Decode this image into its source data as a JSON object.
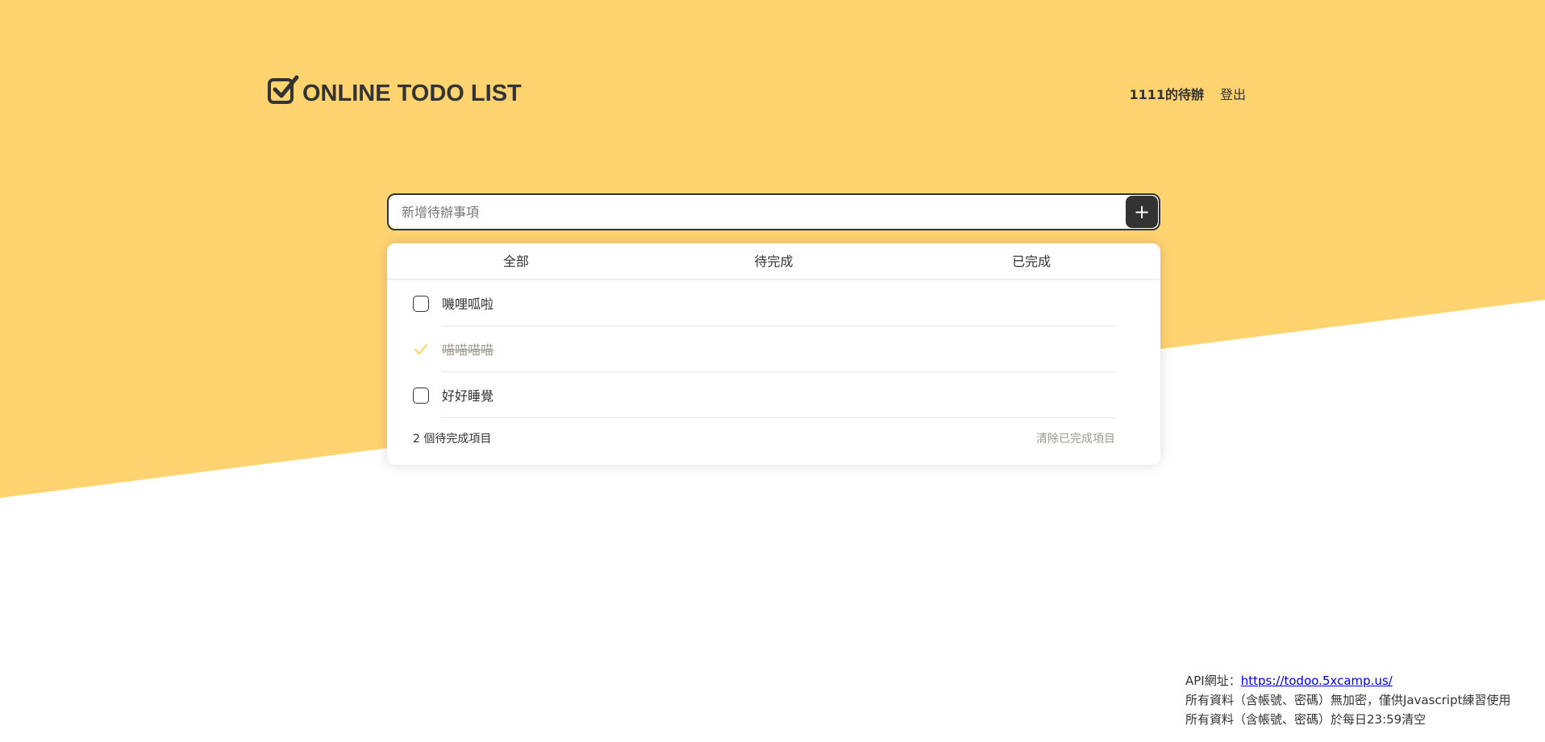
{
  "colors": {
    "background_yellow": "#FFD370",
    "dark": "#333333",
    "check": "#FFD370",
    "muted": "#9F9A91"
  },
  "header": {
    "logo_icon": "checked-box-icon",
    "logo_text": "ONLINE TODO LIST",
    "user_label": "1111的待辦",
    "logout_label": "登出"
  },
  "add_form": {
    "placeholder": "新增待辦事項",
    "value": "",
    "add_button_label": "+"
  },
  "tabs": [
    {
      "label": "全部",
      "active": true
    },
    {
      "label": "待完成",
      "active": false
    },
    {
      "label": "已完成",
      "active": false
    }
  ],
  "todos": [
    {
      "text": "嘰哩呱啦",
      "done": false
    },
    {
      "text": "喵喵喵喵",
      "done": true
    },
    {
      "text": "好好睡覺",
      "done": false
    }
  ],
  "list_footer": {
    "pending_text": "2 個待完成項目",
    "clear_label": "清除已完成項目"
  },
  "page_footer": {
    "api_prefix": "API網址：",
    "api_url": "https://todoo.5xcamp.us/",
    "line2": "所有資料（含帳號、密碼）無加密，僅供Javascript練習使用",
    "line3": "所有資料（含帳號、密碼）於每日23:59清空"
  }
}
